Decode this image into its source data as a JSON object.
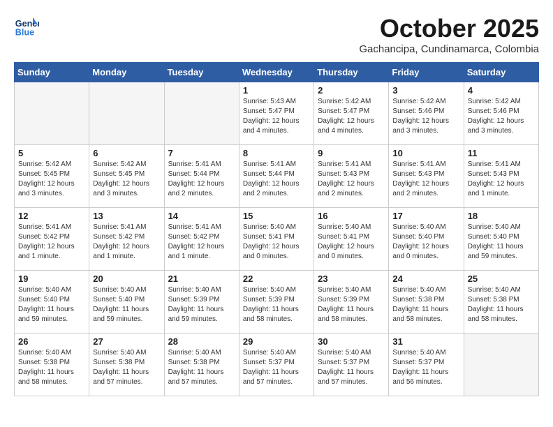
{
  "header": {
    "logo_line1": "General",
    "logo_line2": "Blue",
    "month_title": "October 2025",
    "location": "Gachancipa, Cundinamarca, Colombia"
  },
  "weekdays": [
    "Sunday",
    "Monday",
    "Tuesday",
    "Wednesday",
    "Thursday",
    "Friday",
    "Saturday"
  ],
  "weeks": [
    [
      {
        "day": "",
        "info": ""
      },
      {
        "day": "",
        "info": ""
      },
      {
        "day": "",
        "info": ""
      },
      {
        "day": "1",
        "info": "Sunrise: 5:43 AM\nSunset: 5:47 PM\nDaylight: 12 hours\nand 4 minutes."
      },
      {
        "day": "2",
        "info": "Sunrise: 5:42 AM\nSunset: 5:47 PM\nDaylight: 12 hours\nand 4 minutes."
      },
      {
        "day": "3",
        "info": "Sunrise: 5:42 AM\nSunset: 5:46 PM\nDaylight: 12 hours\nand 3 minutes."
      },
      {
        "day": "4",
        "info": "Sunrise: 5:42 AM\nSunset: 5:46 PM\nDaylight: 12 hours\nand 3 minutes."
      }
    ],
    [
      {
        "day": "5",
        "info": "Sunrise: 5:42 AM\nSunset: 5:45 PM\nDaylight: 12 hours\nand 3 minutes."
      },
      {
        "day": "6",
        "info": "Sunrise: 5:42 AM\nSunset: 5:45 PM\nDaylight: 12 hours\nand 3 minutes."
      },
      {
        "day": "7",
        "info": "Sunrise: 5:41 AM\nSunset: 5:44 PM\nDaylight: 12 hours\nand 2 minutes."
      },
      {
        "day": "8",
        "info": "Sunrise: 5:41 AM\nSunset: 5:44 PM\nDaylight: 12 hours\nand 2 minutes."
      },
      {
        "day": "9",
        "info": "Sunrise: 5:41 AM\nSunset: 5:43 PM\nDaylight: 12 hours\nand 2 minutes."
      },
      {
        "day": "10",
        "info": "Sunrise: 5:41 AM\nSunset: 5:43 PM\nDaylight: 12 hours\nand 2 minutes."
      },
      {
        "day": "11",
        "info": "Sunrise: 5:41 AM\nSunset: 5:43 PM\nDaylight: 12 hours\nand 1 minute."
      }
    ],
    [
      {
        "day": "12",
        "info": "Sunrise: 5:41 AM\nSunset: 5:42 PM\nDaylight: 12 hours\nand 1 minute."
      },
      {
        "day": "13",
        "info": "Sunrise: 5:41 AM\nSunset: 5:42 PM\nDaylight: 12 hours\nand 1 minute."
      },
      {
        "day": "14",
        "info": "Sunrise: 5:41 AM\nSunset: 5:42 PM\nDaylight: 12 hours\nand 1 minute."
      },
      {
        "day": "15",
        "info": "Sunrise: 5:40 AM\nSunset: 5:41 PM\nDaylight: 12 hours\nand 0 minutes."
      },
      {
        "day": "16",
        "info": "Sunrise: 5:40 AM\nSunset: 5:41 PM\nDaylight: 12 hours\nand 0 minutes."
      },
      {
        "day": "17",
        "info": "Sunrise: 5:40 AM\nSunset: 5:40 PM\nDaylight: 12 hours\nand 0 minutes."
      },
      {
        "day": "18",
        "info": "Sunrise: 5:40 AM\nSunset: 5:40 PM\nDaylight: 11 hours\nand 59 minutes."
      }
    ],
    [
      {
        "day": "19",
        "info": "Sunrise: 5:40 AM\nSunset: 5:40 PM\nDaylight: 11 hours\nand 59 minutes."
      },
      {
        "day": "20",
        "info": "Sunrise: 5:40 AM\nSunset: 5:40 PM\nDaylight: 11 hours\nand 59 minutes."
      },
      {
        "day": "21",
        "info": "Sunrise: 5:40 AM\nSunset: 5:39 PM\nDaylight: 11 hours\nand 59 minutes."
      },
      {
        "day": "22",
        "info": "Sunrise: 5:40 AM\nSunset: 5:39 PM\nDaylight: 11 hours\nand 58 minutes."
      },
      {
        "day": "23",
        "info": "Sunrise: 5:40 AM\nSunset: 5:39 PM\nDaylight: 11 hours\nand 58 minutes."
      },
      {
        "day": "24",
        "info": "Sunrise: 5:40 AM\nSunset: 5:38 PM\nDaylight: 11 hours\nand 58 minutes."
      },
      {
        "day": "25",
        "info": "Sunrise: 5:40 AM\nSunset: 5:38 PM\nDaylight: 11 hours\nand 58 minutes."
      }
    ],
    [
      {
        "day": "26",
        "info": "Sunrise: 5:40 AM\nSunset: 5:38 PM\nDaylight: 11 hours\nand 58 minutes."
      },
      {
        "day": "27",
        "info": "Sunrise: 5:40 AM\nSunset: 5:38 PM\nDaylight: 11 hours\nand 57 minutes."
      },
      {
        "day": "28",
        "info": "Sunrise: 5:40 AM\nSunset: 5:38 PM\nDaylight: 11 hours\nand 57 minutes."
      },
      {
        "day": "29",
        "info": "Sunrise: 5:40 AM\nSunset: 5:37 PM\nDaylight: 11 hours\nand 57 minutes."
      },
      {
        "day": "30",
        "info": "Sunrise: 5:40 AM\nSunset: 5:37 PM\nDaylight: 11 hours\nand 57 minutes."
      },
      {
        "day": "31",
        "info": "Sunrise: 5:40 AM\nSunset: 5:37 PM\nDaylight: 11 hours\nand 56 minutes."
      },
      {
        "day": "",
        "info": ""
      }
    ]
  ]
}
